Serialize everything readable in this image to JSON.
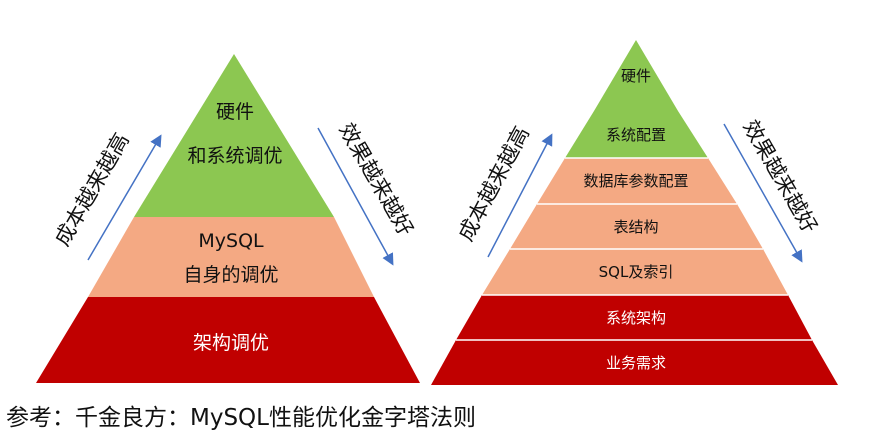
{
  "left_pyramid": {
    "layers": [
      {
        "lines": [
          "硬件",
          "和系统调优"
        ],
        "color": "#8CC751",
        "text_color": "#111111"
      },
      {
        "lines": [
          "MySQL",
          "自身的调优"
        ],
        "color": "#F4A983",
        "text_color": "#111111"
      },
      {
        "lines": [
          "架构调优"
        ],
        "color": "#C00000",
        "text_color": "#ffffff"
      }
    ],
    "left_arrow_label": "成本越来越高",
    "right_arrow_label": "效果越来越好"
  },
  "right_pyramid": {
    "layers": [
      {
        "label": "硬件",
        "color": "#8CC751",
        "text_color": "#111111"
      },
      {
        "label": "系统配置",
        "color": "#8CC751",
        "text_color": "#111111"
      },
      {
        "label": "数据库参数配置",
        "color": "#F4A983",
        "text_color": "#111111"
      },
      {
        "label": "表结构",
        "color": "#F4A983",
        "text_color": "#111111"
      },
      {
        "label": "SQL及索引",
        "color": "#F4A983",
        "text_color": "#111111"
      },
      {
        "label": "系统架构",
        "color": "#C00000",
        "text_color": "#ffffff"
      },
      {
        "label": "业务需求",
        "color": "#C00000",
        "text_color": "#ffffff"
      }
    ],
    "left_arrow_label": "成本越来越高",
    "right_arrow_label": "效果越来越好"
  },
  "caption": "参考：千金良方：MySQL性能优化金字塔法则",
  "arrow_color": "#4472C4"
}
